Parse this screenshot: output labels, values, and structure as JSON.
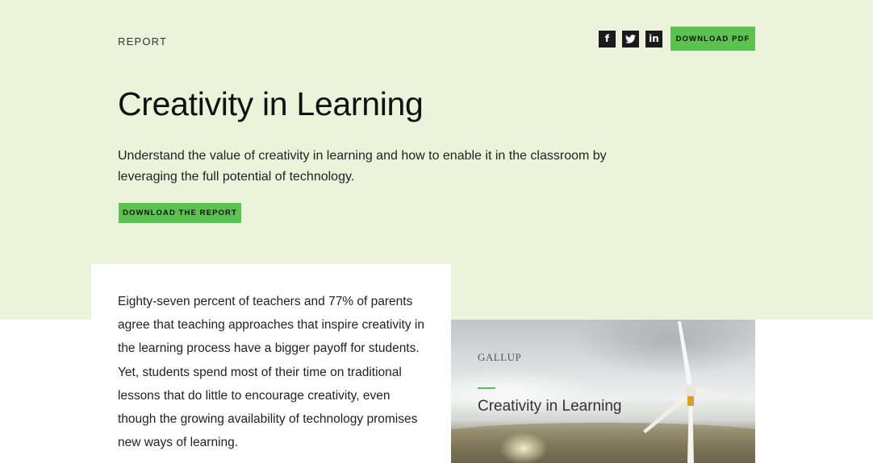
{
  "header": {
    "eyebrow": "REPORT",
    "download_pdf_label": "DOWNLOAD PDF"
  },
  "social": [
    {
      "name": "facebook-icon",
      "glyph": "f"
    },
    {
      "name": "twitter-icon",
      "glyph": ""
    },
    {
      "name": "linkedin-icon",
      "glyph": "in"
    }
  ],
  "hero": {
    "title": "Creativity in Learning",
    "description": "Understand the value of creativity in learning and how to enable it in the classroom by leveraging the full potential of technology.",
    "cta_label": "DOWNLOAD THE REPORT"
  },
  "intro": {
    "text": "Eighty-seven percent of teachers and 77% of parents agree that teaching approaches that inspire creativity in the learning process have a bigger payoff for students. Yet, students spend most of their time on traditional lessons that do little to encourage creativity, even though the growing availability of technology promises new ways of learning."
  },
  "cover": {
    "brand": "GALLUP",
    "title": "Creativity in Learning"
  },
  "colors": {
    "hero_bg": "#ebf3da",
    "accent_green": "#5bc14f",
    "icon_bg": "#1b1b1b"
  }
}
